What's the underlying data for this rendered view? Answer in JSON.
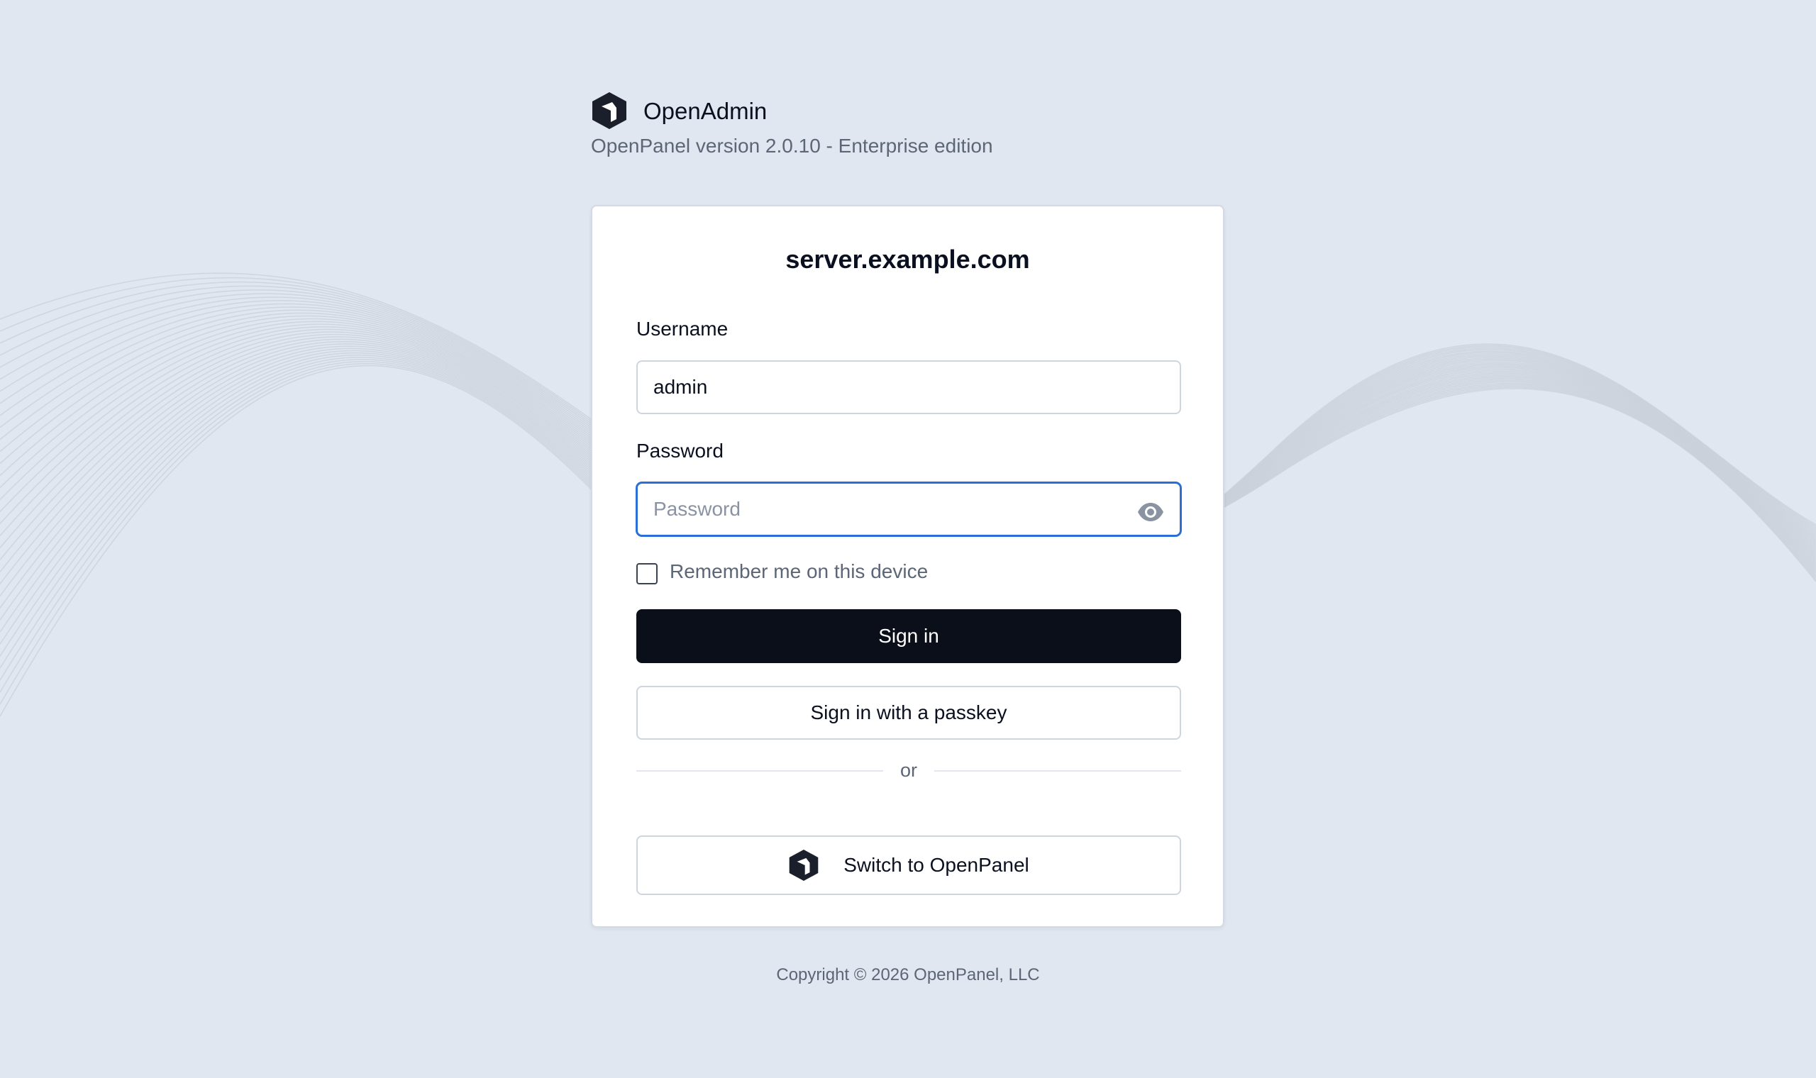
{
  "brand": {
    "name": "OpenAdmin",
    "version_text": "OpenPanel version 2.0.10 - Enterprise edition",
    "logo_icon": "openpanel-hexagon-logo-icon",
    "logo_color": "#1a1f2b"
  },
  "login": {
    "hostname": "server.example.com",
    "username_label": "Username",
    "username_value": "admin",
    "password_label": "Password",
    "password_placeholder": "Password",
    "password_value": "",
    "show_password_icon": "eye-icon",
    "remember_label": "Remember me on this device",
    "remember_checked": false,
    "sign_in_label": "Sign in",
    "passkey_label": "Sign in with a passkey",
    "divider_text": "or",
    "switch_label": "Switch to OpenPanel"
  },
  "footer": {
    "copyright": "Copyright © 2026 OpenPanel, LLC"
  },
  "colors": {
    "background": "#e1e7f0",
    "primary_button": "#0b0f19",
    "focus_border": "#2b6fd6",
    "muted_text": "#5c6676",
    "wave_lines": "#c9d0da"
  }
}
